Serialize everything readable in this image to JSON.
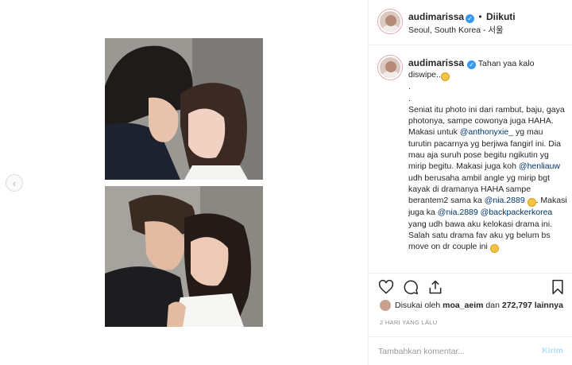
{
  "post": {
    "username": "audimarissa",
    "follow_dot": "•",
    "follow_status": "Diikuti",
    "location": "Seoul, South Korea - 서울"
  },
  "caption": {
    "username": "audimarissa",
    "line_a": "Tahan yaa kalo diswipe..",
    "line_b": "\n.\n.\nSeniat itu photo ini dari rambut, baju, gaya photonya, sampe cowonya juga HAHA. Makasi untuk ",
    "mention1": "@anthonyxie_",
    "line_c": " yg mau turutin pacarnya yg berjiwa fangirl ini. Dia mau aja suruh pose begitu ngikutin yg mirip begitu. Makasi juga koh ",
    "mention2": "@henliauw",
    "line_d": " udh berusaha ambil angle yg mirip bgt kayak di dramanya HAHA sampe berantem2 sama ka ",
    "mention3": "@nia.2889",
    "line_e": ". Makasi juga ka ",
    "mention4": "@nia.2889",
    "line_f": " ",
    "mention5": "@backpackerkorea",
    "line_g": " yang udh bawa aku kelokasi drama ini. Salah satu drama fav aku yg belum bs move on dr couple ini "
  },
  "likes": {
    "prefix": "Disukai oleh",
    "user": "moa_aeim",
    "middle": "dan",
    "count": "272,797 lainnya"
  },
  "time_ago": "2 HARI YANG LALU",
  "comment": {
    "placeholder": "Tambahkan komentar...",
    "post_label": "Kirim"
  },
  "icons": {
    "prev": "chevron-left-icon",
    "like": "heart-icon",
    "comment": "comment-bubble-icon",
    "share": "share-icon",
    "save": "bookmark-icon",
    "verified": "verified-badge-icon",
    "emoji": "laughing-emoji-icon"
  },
  "colors": {
    "accent": "#3897f0",
    "mention": "#003569",
    "muted": "#8e8e8e",
    "post_disabled": "#b2dffc"
  }
}
